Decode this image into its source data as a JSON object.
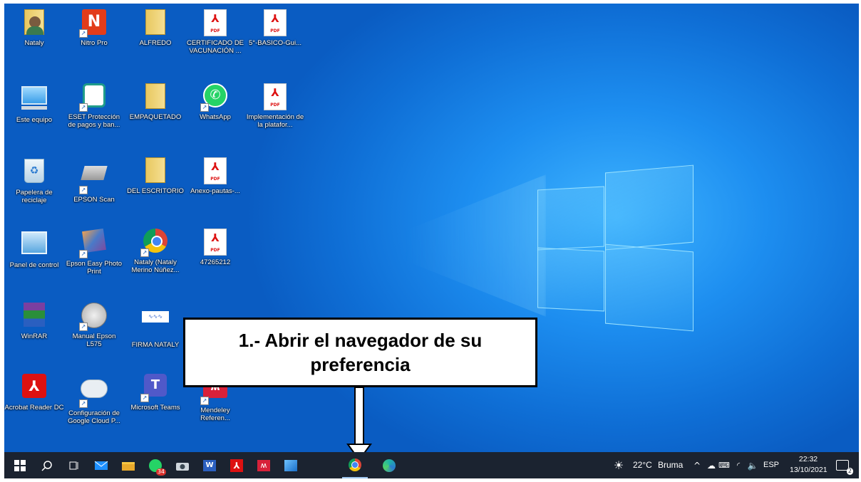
{
  "desktop": {
    "icons": [
      {
        "label": "Nataly",
        "icon": "user-folder-icon"
      },
      {
        "label": "Nitro Pro",
        "icon": "nitro-pro-icon"
      },
      {
        "label": "ALFREDO",
        "icon": "folder-icon"
      },
      {
        "label": "CERTIFICADO DE VACUNACIÓN ...",
        "icon": "pdf-icon"
      },
      {
        "label": "5°-BASICO-Gui...",
        "icon": "pdf-icon"
      },
      {
        "label": "Este equipo",
        "icon": "computer-icon"
      },
      {
        "label": "ESET Protección de pagos y ban...",
        "icon": "eset-icon"
      },
      {
        "label": "EMPAQUETADO",
        "icon": "folder-icon"
      },
      {
        "label": "WhatsApp",
        "icon": "whatsapp-icon"
      },
      {
        "label": "Implementación de la platafor...",
        "icon": "pdf-icon"
      },
      {
        "label": "Papelera de reciclaje",
        "icon": "recycle-bin-icon"
      },
      {
        "label": "EPSON Scan",
        "icon": "scanner-icon"
      },
      {
        "label": "DEL ESCRITORIO",
        "icon": "folder-icon"
      },
      {
        "label": "Anexo-pautas-...",
        "icon": "pdf-icon"
      },
      {
        "label": "Panel de control",
        "icon": "control-panel-icon"
      },
      {
        "label": "Epson Easy Photo Print",
        "icon": "photo-print-icon"
      },
      {
        "label": "Nataly (Nataly Merino Núñez...",
        "icon": "chrome-profile-icon"
      },
      {
        "label": "47265212",
        "icon": "pdf-icon"
      },
      {
        "label": "WinRAR",
        "icon": "winrar-icon"
      },
      {
        "label": "Manual Epson L575",
        "icon": "manual-icon"
      },
      {
        "label": "FIRMA NATALY",
        "icon": "signature-image-icon"
      },
      {
        "label": "Acrobat Reader DC",
        "icon": "acrobat-icon"
      },
      {
        "label": "Configuración de Google Cloud P...",
        "icon": "cloud-print-icon"
      },
      {
        "label": "Microsoft Teams",
        "icon": "teams-icon"
      },
      {
        "label": "Mendeley Referen...",
        "icon": "mendeley-icon"
      }
    ]
  },
  "callout": {
    "line1": "1.- Abrir el navegador de su",
    "line2": "preferencia"
  },
  "taskbar": {
    "weather_temp": "22°C",
    "weather_desc": "Bruma",
    "language": "ESP",
    "time": "22:32",
    "date": "13/10/2021",
    "notifications": "2",
    "whatsapp_badge": "34"
  },
  "colors": {
    "desktop_blue": "#0f6fd6",
    "taskbar": "#1b2330",
    "pdf_red": "#dd1111"
  }
}
